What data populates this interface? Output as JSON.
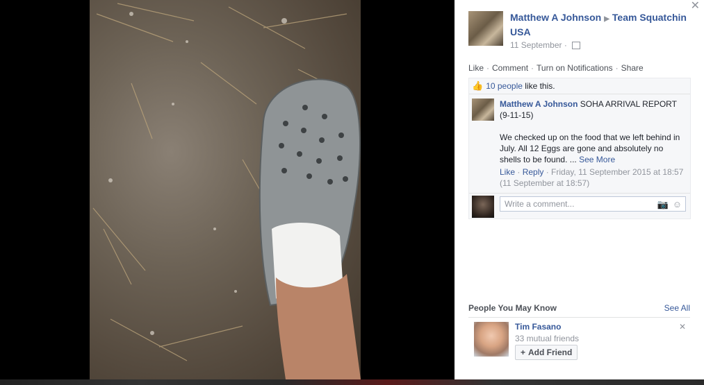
{
  "post": {
    "author": "Matthew A Johnson",
    "target": "Team Squatchin USA",
    "date": "11 September"
  },
  "actions": {
    "like": "Like",
    "comment": "Comment",
    "notifications": "Turn on Notifications",
    "share": "Share"
  },
  "likes": {
    "count_text": "10 people",
    "suffix": "like this."
  },
  "comment": {
    "author": "Matthew A Johnson",
    "title": "SOHA ARRIVAL REPORT (9-11-15)",
    "body": "We checked up on the food that we left behind in July. All 12 Eggs are gone and absolutely no shells to be found. ...",
    "see_more": "See More",
    "like": "Like",
    "reply": "Reply",
    "timestamp": "Friday, 11 September 2015 at 18:57 (11 September at 18:57)"
  },
  "write_comment": {
    "placeholder": "Write a comment..."
  },
  "pymk": {
    "title": "People You May Know",
    "see_all": "See All",
    "person": {
      "name": "Tim Fasano",
      "mutual": "33 mutual friends",
      "add_label": "Add Friend"
    }
  },
  "colors": {
    "link": "#365899",
    "meta": "#90949c",
    "feedback_bg": "#f6f7f9"
  }
}
